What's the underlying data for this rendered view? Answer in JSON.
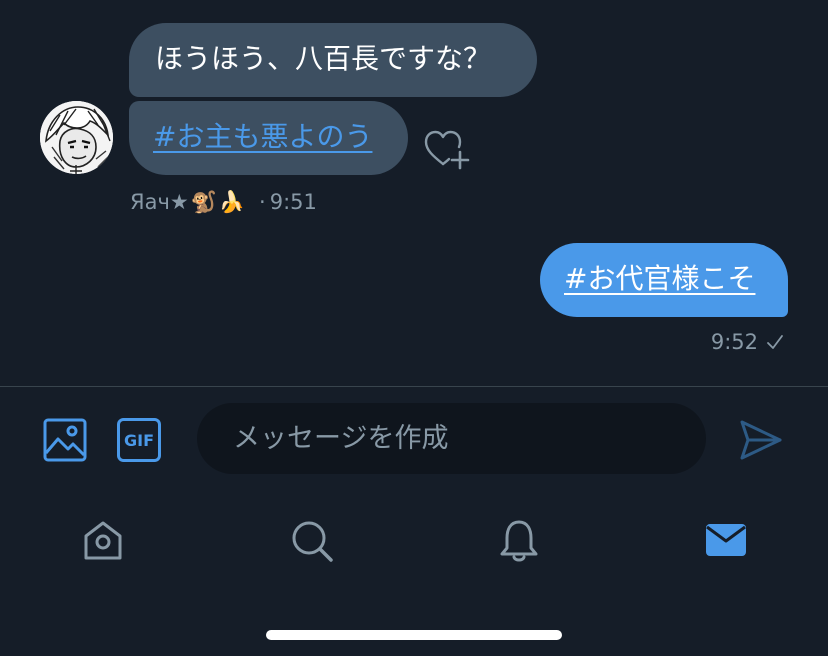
{
  "thread": {
    "incoming": {
      "message_1": "ほうほう、八百長ですな？",
      "message_2": "#お主も悪よのう",
      "sender": "Яач★",
      "sender_emoji_1": "🐒",
      "sender_emoji_2": "🍌",
      "dot": "·",
      "time": "9:51"
    },
    "outgoing": {
      "message_1": "#お代官様こそ",
      "time": "9:52"
    }
  },
  "composer": {
    "placeholder": "メッセージを作成",
    "value": ""
  },
  "icons": {
    "like": "heart-plus-icon",
    "media": "image-icon",
    "gif": "gif-icon",
    "gif_label": "GIF",
    "send": "send-icon",
    "read_status": "checkmark-icon"
  },
  "tabbar": {
    "items": [
      "home",
      "search",
      "notifications",
      "messages"
    ],
    "active": "messages"
  },
  "colors": {
    "background": "#151d28",
    "incoming_bubble": "#3d4f61",
    "outgoing_bubble": "#4a99e9",
    "accent": "#4a99e9",
    "muted_text": "#8899a6",
    "composer_bg": "#0f151d"
  }
}
